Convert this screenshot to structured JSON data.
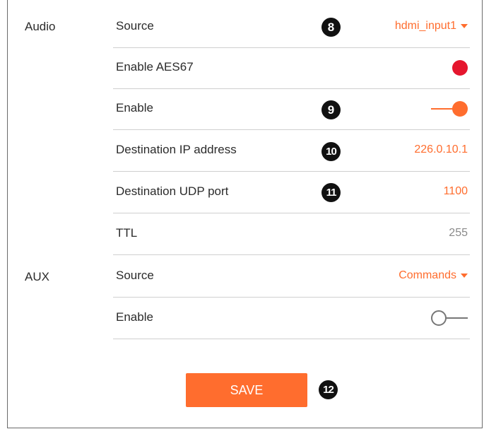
{
  "accent_color": "#ff6d2e",
  "audio": {
    "section_label": "Audio",
    "rows": [
      {
        "label": "Source",
        "value": "hdmi_input1",
        "control": "dropdown",
        "callout": "8"
      },
      {
        "label": "Enable AES67",
        "control": "indicator",
        "indicator_color": "#e5162e"
      },
      {
        "label": "Enable",
        "control": "toggle",
        "state": "on",
        "callout": "9"
      },
      {
        "label": "Destination IP address",
        "value": "226.0.10.1",
        "callout": "10"
      },
      {
        "label": "Destination UDP port",
        "value": "1100",
        "callout": "11"
      },
      {
        "label": "TTL",
        "value": "255",
        "readonly": true
      }
    ]
  },
  "aux": {
    "section_label": "AUX",
    "rows": [
      {
        "label": "Source",
        "value": "Commands",
        "control": "dropdown"
      },
      {
        "label": "Enable",
        "control": "toggle",
        "state": "off"
      }
    ]
  },
  "save": {
    "label": "SAVE",
    "callout": "12"
  }
}
